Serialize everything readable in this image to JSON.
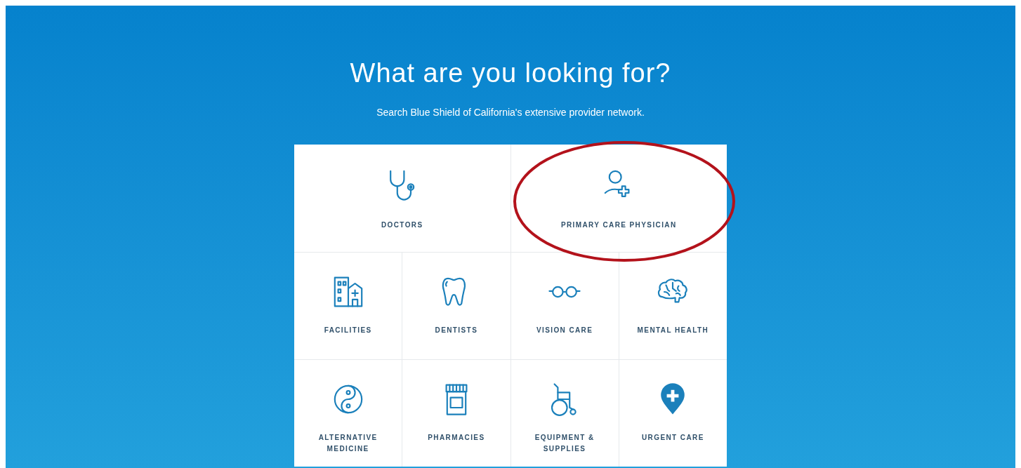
{
  "heading": "What are you looking for?",
  "subheading": "Search Blue Shield of California's extensive provider network.",
  "rows": [
    {
      "tiles": [
        {
          "label": "DOCTORS",
          "circled": false
        },
        {
          "label": "PRIMARY CARE PHYSICIAN",
          "circled": true
        }
      ]
    },
    {
      "tiles": [
        {
          "label": "FACILITIES",
          "circled": false
        },
        {
          "label": "DENTISTS",
          "circled": false
        },
        {
          "label": "VISION CARE",
          "circled": false
        },
        {
          "label": "MENTAL HEALTH",
          "circled": false
        }
      ]
    },
    {
      "tiles": [
        {
          "label": "ALTERNATIVE MEDICINE",
          "circled": false
        },
        {
          "label": "PHARMACIES",
          "circled": false
        },
        {
          "label": "EQUIPMENT & SUPPLIES",
          "circled": false
        },
        {
          "label": "URGENT CARE",
          "circled": false
        }
      ]
    }
  ]
}
